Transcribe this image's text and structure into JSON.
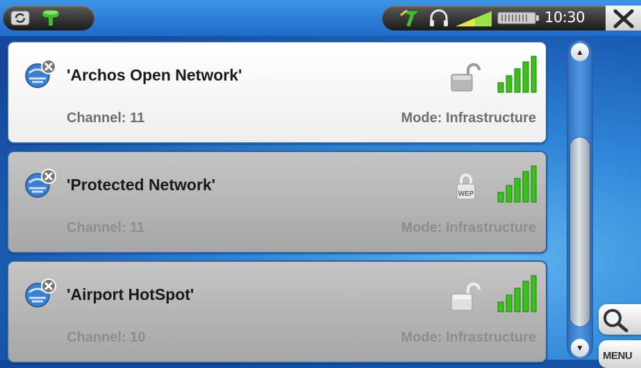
{
  "status_bar": {
    "left_icons": [
      "sync-icon",
      "wifi-connection-icon"
    ],
    "right_icons": [
      "wifi-connection-icon",
      "headphones-icon",
      "volume-icon",
      "battery-icon"
    ],
    "time": "10:30",
    "close_icon": "close-icon"
  },
  "networks": [
    {
      "name": "'Archos Open Network'",
      "channel": "Channel: 11",
      "mode": "Mode: Infrastructure",
      "security_icon": "unlocked-icon",
      "signal": 1.0,
      "selected": true
    },
    {
      "name": "'Protected Network'",
      "channel": "Channel: 11",
      "mode": "Mode: Infrastructure",
      "security_icon": "wep-lock-icon",
      "security_label": "WEP",
      "signal": 1.0,
      "selected": false
    },
    {
      "name": "'Airport HotSpot'",
      "channel": "Channel: 10",
      "mode": "Mode: Infrastructure",
      "security_icon": "unlocked-icon",
      "signal": 1.0,
      "selected": false
    }
  ],
  "side_buttons": {
    "search_icon": "search-icon",
    "menu_label": "MENU"
  },
  "colors": {
    "signal_green": "#39c21a",
    "background_blue": "#2f86d8"
  }
}
